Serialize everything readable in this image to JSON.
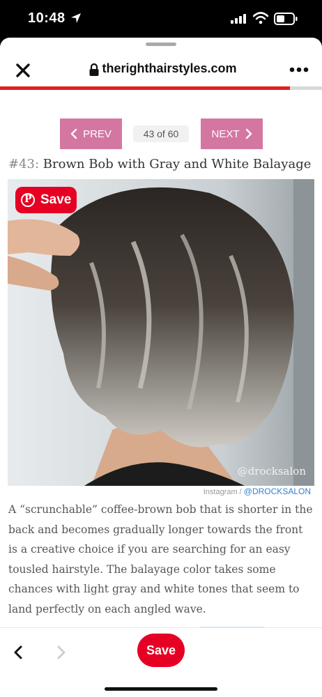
{
  "status_bar": {
    "time": "10:48"
  },
  "browser": {
    "url": "therighthairstyles.com",
    "icons": [
      "close-icon",
      "lock-icon",
      "more-icon"
    ],
    "page_load_progress": 0.9
  },
  "pager": {
    "prev_label": "PREV",
    "next_label": "NEXT",
    "count": "43 of 60",
    "button_color": "#d477a0"
  },
  "article": {
    "heading_number": "#43:",
    "heading_title": "Brown Bob with Gray and White Balayage",
    "image_watermark": "@drocksalon",
    "pin_save_label": "Save",
    "credit_source": "Instagram / ",
    "credit_handle": "@DROCKSALON",
    "description": "A “scrunchable” coffee-brown bob that is shorter in the back and becomes gradually longer towards the front is a creative choice if you are searching for an easy tousled hairstyle. The balayage color takes some chances with light gray and white tones that seem to land perfectly on each angled wave."
  },
  "bottom_bar": {
    "save_label": "Save",
    "accent_color": "#e60023"
  }
}
